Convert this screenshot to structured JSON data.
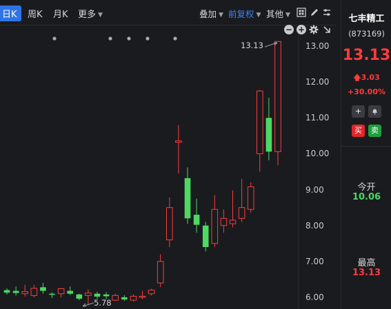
{
  "toolbar": {
    "periods": [
      {
        "label": "日K",
        "active": true
      },
      {
        "label": "周K",
        "active": false
      },
      {
        "label": "月K",
        "active": false
      },
      {
        "label": "更多",
        "active": false
      }
    ],
    "overlay_label": "叠加",
    "adjust_label": "前复权",
    "other_label": "其他"
  },
  "chart": {
    "y_ticks": [
      "13.00",
      "12.00",
      "11.00",
      "10.00",
      "9.00",
      "8.00",
      "7.00",
      "6.00"
    ],
    "high_annotation": "13.13",
    "low_annotation": "5.78"
  },
  "chart_data": {
    "type": "candlestick",
    "ylim": [
      5.8,
      13.2
    ],
    "candles": [
      {
        "o": 6.2,
        "c": 6.13,
        "h": 6.25,
        "l": 6.08
      },
      {
        "o": 6.18,
        "c": 6.12,
        "h": 6.3,
        "l": 6.05
      },
      {
        "o": 6.1,
        "c": 6.16,
        "h": 6.35,
        "l": 6.02
      },
      {
        "o": 6.05,
        "c": 6.25,
        "h": 6.35,
        "l": 6.0
      },
      {
        "o": 6.28,
        "c": 6.18,
        "h": 6.4,
        "l": 6.1
      },
      {
        "o": 6.1,
        "c": 6.08,
        "h": 6.14,
        "l": 5.98
      },
      {
        "o": 6.1,
        "c": 6.24,
        "h": 6.26,
        "l": 6.0
      },
      {
        "o": 6.18,
        "c": 6.1,
        "h": 6.3,
        "l": 6.06
      },
      {
        "o": 6.08,
        "c": 5.96,
        "h": 6.1,
        "l": 5.92
      },
      {
        "o": 6.05,
        "c": 6.12,
        "h": 6.22,
        "l": 5.78
      },
      {
        "o": 6.1,
        "c": 6.02,
        "h": 6.15,
        "l": 5.96
      },
      {
        "o": 6.08,
        "c": 6.03,
        "h": 6.14,
        "l": 5.95
      },
      {
        "o": 5.92,
        "c": 6.05,
        "h": 6.1,
        "l": 5.9
      },
      {
        "o": 6.0,
        "c": 5.94,
        "h": 6.06,
        "l": 5.9
      },
      {
        "o": 5.92,
        "c": 6.03,
        "h": 6.08,
        "l": 5.88
      },
      {
        "o": 6.0,
        "c": 6.03,
        "h": 6.18,
        "l": 5.95
      },
      {
        "o": 6.1,
        "c": 6.2,
        "h": 6.24,
        "l": 6.05
      },
      {
        "o": 6.4,
        "c": 7.0,
        "h": 7.2,
        "l": 6.28
      },
      {
        "o": 7.6,
        "c": 8.5,
        "h": 8.78,
        "l": 7.4
      },
      {
        "o": 10.32,
        "c": 10.36,
        "h": 10.8,
        "l": 9.45
      },
      {
        "o": 9.32,
        "c": 8.2,
        "h": 9.62,
        "l": 8.05
      },
      {
        "o": 8.3,
        "c": 8.02,
        "h": 8.75,
        "l": 7.8
      },
      {
        "o": 8.0,
        "c": 7.4,
        "h": 8.1,
        "l": 7.28
      },
      {
        "o": 7.5,
        "c": 8.45,
        "h": 8.85,
        "l": 7.4
      },
      {
        "o": 8.0,
        "c": 8.2,
        "h": 8.45,
        "l": 7.8
      },
      {
        "o": 8.05,
        "c": 8.15,
        "h": 8.98,
        "l": 7.95
      },
      {
        "o": 8.2,
        "c": 8.5,
        "h": 9.3,
        "l": 8.1
      },
      {
        "o": 8.45,
        "c": 9.08,
        "h": 9.2,
        "l": 8.36
      },
      {
        "o": 10.0,
        "c": 11.75,
        "h": 11.78,
        "l": 9.5
      },
      {
        "o": 11.0,
        "c": 10.06,
        "h": 11.56,
        "l": 9.82
      },
      {
        "o": 10.06,
        "c": 13.13,
        "h": 13.13,
        "l": 9.68
      }
    ]
  },
  "panel": {
    "stock_name": "七丰精工",
    "stock_code": "(873169)",
    "price": "13.13",
    "change": "3.03",
    "change_pct": "+30.00%",
    "buy_label": "买",
    "sell_label": "卖",
    "open_label": "今开",
    "open_value": "10.06",
    "high_label": "最高",
    "high_value": "13.13",
    "colors": {
      "up": "#ff3b3b",
      "down": "#4cd964",
      "accent": "#2f74e5"
    }
  }
}
